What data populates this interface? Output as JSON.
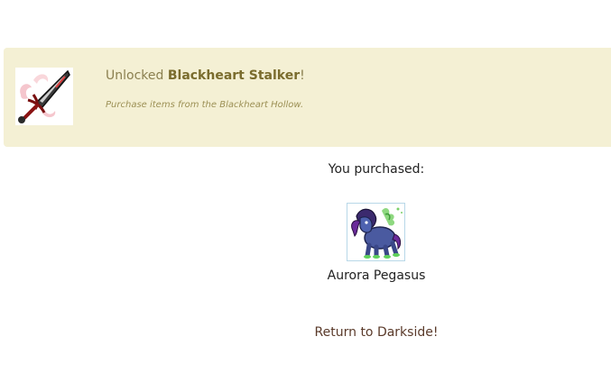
{
  "banner": {
    "prefix": "Unlocked ",
    "achievement_name": "Blackheart Stalker",
    "suffix": "!",
    "subtitle": "Purchase items from the Blackheart Hollow.",
    "badge_icon": "sword-badge-icon"
  },
  "purchase": {
    "label": "You purchased:",
    "item_name": "Aurora Pegasus",
    "item_icon": "pegasus-icon"
  },
  "return_link": "Return to Darkside!",
  "colors": {
    "banner_bg": "#f4f0d4",
    "banner_text": "#8b8050",
    "link": "#5a3a2a"
  }
}
